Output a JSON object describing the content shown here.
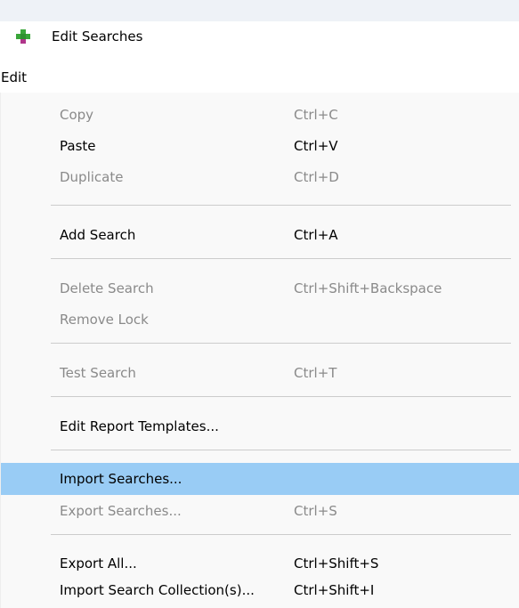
{
  "window": {
    "title": "Edit Searches",
    "icon": "app-cross-icon"
  },
  "menubar": {
    "items": [
      {
        "label": "Edit"
      }
    ]
  },
  "menu": {
    "items": [
      {
        "label": "Copy",
        "shortcut": "Ctrl+C",
        "enabled": false
      },
      {
        "label": "Paste",
        "shortcut": "Ctrl+V",
        "enabled": true
      },
      {
        "label": "Duplicate",
        "shortcut": "Ctrl+D",
        "enabled": false
      },
      {
        "label": "Add Search",
        "shortcut": "Ctrl+A",
        "enabled": true
      },
      {
        "label": "Delete Search",
        "shortcut": "Ctrl+Shift+Backspace",
        "enabled": false
      },
      {
        "label": "Remove Lock",
        "shortcut": "",
        "enabled": false
      },
      {
        "label": "Test Search",
        "shortcut": "Ctrl+T",
        "enabled": false
      },
      {
        "label": "Edit Report Templates...",
        "shortcut": "",
        "enabled": true
      },
      {
        "label": "Import Searches...",
        "shortcut": "",
        "enabled": true,
        "highlighted": true
      },
      {
        "label": "Export Searches...",
        "shortcut": "Ctrl+S",
        "enabled": false
      },
      {
        "label": "Export All...",
        "shortcut": "Ctrl+Shift+S",
        "enabled": true
      },
      {
        "label": "Import Search Collection(s)...",
        "shortcut": "Ctrl+Shift+I",
        "enabled": true
      }
    ]
  },
  "colors": {
    "highlight": "#99ccf5",
    "disabled_text": "#8a8a8a",
    "enabled_text": "#000000",
    "separator": "#cccccc",
    "icon_green": "#3aa63a",
    "icon_magenta": "#b0358a"
  }
}
